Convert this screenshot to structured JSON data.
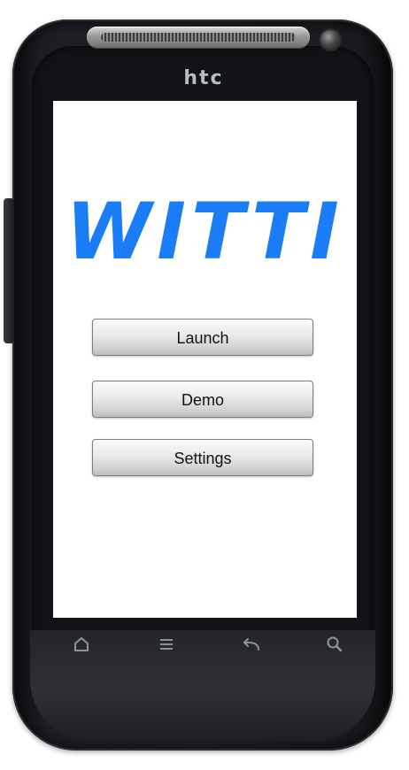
{
  "device": {
    "brand": "htc",
    "frame_color": "#1c1e22",
    "screen_color": "#ffffff"
  },
  "app": {
    "title": "WITTI",
    "title_color": "#1a7cf6"
  },
  "menu": {
    "buttons": [
      {
        "label": "Launch"
      },
      {
        "label": "Demo"
      },
      {
        "label": "Settings"
      }
    ]
  },
  "nav_keys": [
    {
      "icon": "home-icon"
    },
    {
      "icon": "menu-icon"
    },
    {
      "icon": "back-icon"
    },
    {
      "icon": "search-icon"
    }
  ]
}
